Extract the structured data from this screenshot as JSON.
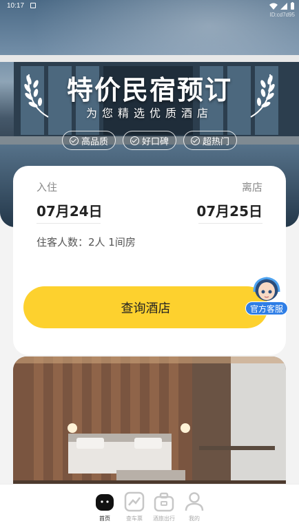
{
  "status": {
    "time": "10:17",
    "id": "ID:cd7d95"
  },
  "hero": {
    "title": "特价民宿预订",
    "subtitle": "为您精选优质酒店",
    "badges": [
      "高品质",
      "好口碑",
      "超热门"
    ]
  },
  "booking": {
    "checkin_label": "入住",
    "checkout_label": "离店",
    "checkin_date": "07月24日",
    "checkout_date": "07月25日",
    "guests": "住客人数：2人 1间房",
    "search_label": "查询酒店"
  },
  "customer_service": {
    "label": "官方客服"
  },
  "tabbar": {
    "items": [
      {
        "label": "首页",
        "icon": "home-icon",
        "active": true
      },
      {
        "label": "查车票",
        "icon": "chart-icon",
        "active": false
      },
      {
        "label": "酒旅出行",
        "icon": "luggage-icon",
        "active": false
      },
      {
        "label": "我的",
        "icon": "user-icon",
        "active": false
      }
    ]
  },
  "colors": {
    "accent": "#fdd12e",
    "service": "#2f7ee6"
  }
}
